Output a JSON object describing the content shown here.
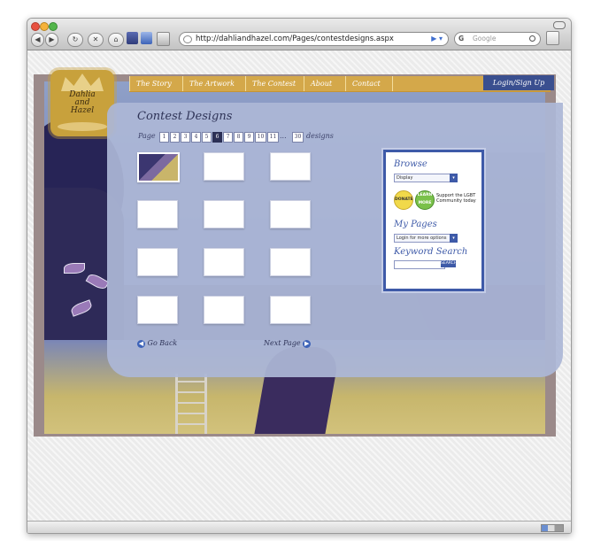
{
  "browser": {
    "url": "http://dahliandhazel.com/Pages/contestdesigns.aspx",
    "search_placeholder": "Google",
    "search_engine_label": "G"
  },
  "site": {
    "logo_text": "Dahlia\nand\nHazel",
    "nav": [
      "The Story",
      "The Artwork",
      "The Contest",
      "About",
      "Contact"
    ],
    "login_label": "Login/Sign Up"
  },
  "main": {
    "title": "Contest Designs",
    "pager_label": "Page",
    "pages": [
      "1",
      "2",
      "3",
      "4",
      "5",
      "6",
      "7",
      "8",
      "9",
      "10",
      "11"
    ],
    "active_page": "6",
    "ellipsis": "...",
    "last_page": "30",
    "designs_label": "designs",
    "go_back": "Go Back",
    "next_page": "Next Page"
  },
  "sidebar": {
    "browse_heading": "Browse",
    "browse_select": "Display",
    "donate_label": "DONATE",
    "learn_more_label": "LEARN MORE",
    "support_text": "Support the LGBT Community today",
    "my_pages_heading": "My Pages",
    "my_pages_select": "Login for more options",
    "keyword_heading": "Keyword Search",
    "keyword_button": "SEARCH"
  },
  "colors": {
    "nav_gold": "#d4a84a",
    "login_blue": "#3a4f8f",
    "panel_lavender": "#acb7d6",
    "accent_blue": "#3e5aa8"
  }
}
